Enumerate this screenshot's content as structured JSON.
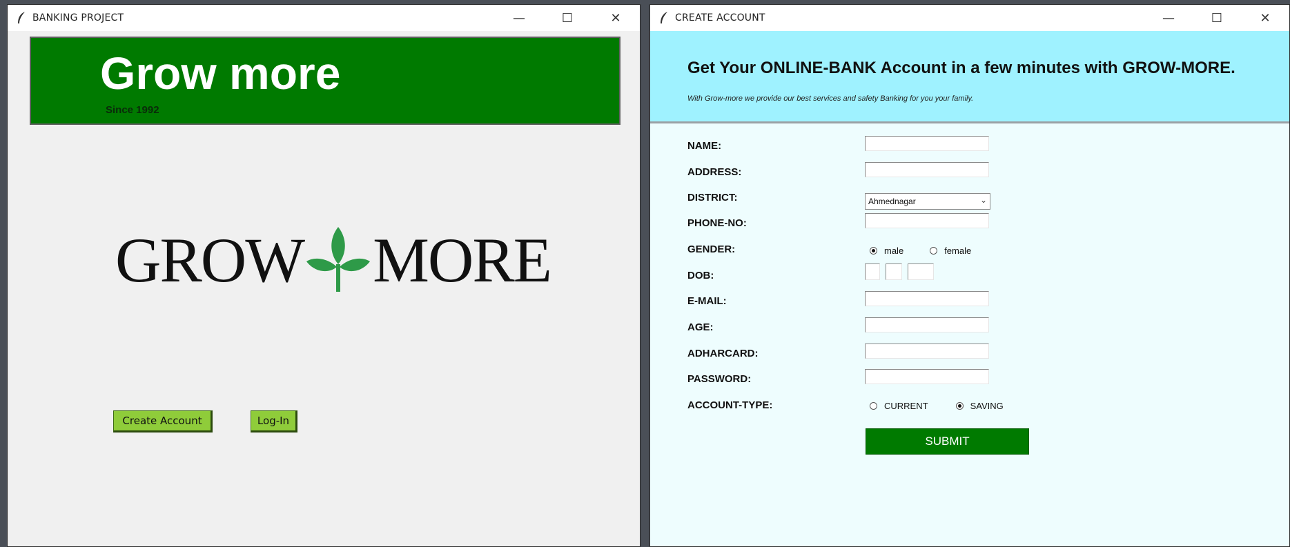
{
  "left_window": {
    "title": "BANKING PROJECT",
    "controls": {
      "minimize": "—",
      "maximize": "☐",
      "close": "✕"
    },
    "banner": {
      "title": "Grow more",
      "subtitle": "Since 1992"
    },
    "logo": {
      "left_word": "GROW",
      "right_word": "MORE",
      "icon": "leaf-icon",
      "leaf_color": "#2e9a48"
    },
    "buttons": {
      "create_account": "Create Account",
      "login": "Log-In"
    },
    "colors": {
      "banner": "#007a00",
      "button": "#8fcc3a"
    }
  },
  "right_window": {
    "title": "CREATE ACCOUNT",
    "controls": {
      "minimize": "—",
      "maximize": "☐",
      "close": "✕"
    },
    "header": {
      "title": "Get Your ONLINE-BANK Account in a few minutes with GROW-MORE.",
      "subtitle": "With Grow-more we provide our best services and safety Banking for you your family."
    },
    "labels": {
      "name": "NAME:",
      "address": "ADDRESS:",
      "district": "DISTRICT:",
      "phone": "PHONE-NO:",
      "gender": "GENDER:",
      "dob": "DOB:",
      "email": "E-MAIL:",
      "age": "AGE:",
      "adharcard": "ADHARCARD:",
      "password": "PASSWORD:",
      "account_type": "ACCOUNT-TYPE:"
    },
    "district": {
      "selected": "Ahmednagar"
    },
    "gender": {
      "options": [
        "male",
        "female"
      ],
      "selected": "male"
    },
    "account_type": {
      "options": [
        "CURRENT",
        "SAVING"
      ],
      "selected": "SAVING"
    },
    "submit": "SUBMIT",
    "colors": {
      "header": "#9ff2ff",
      "background": "#eefdfe",
      "submit": "#007a00"
    }
  }
}
